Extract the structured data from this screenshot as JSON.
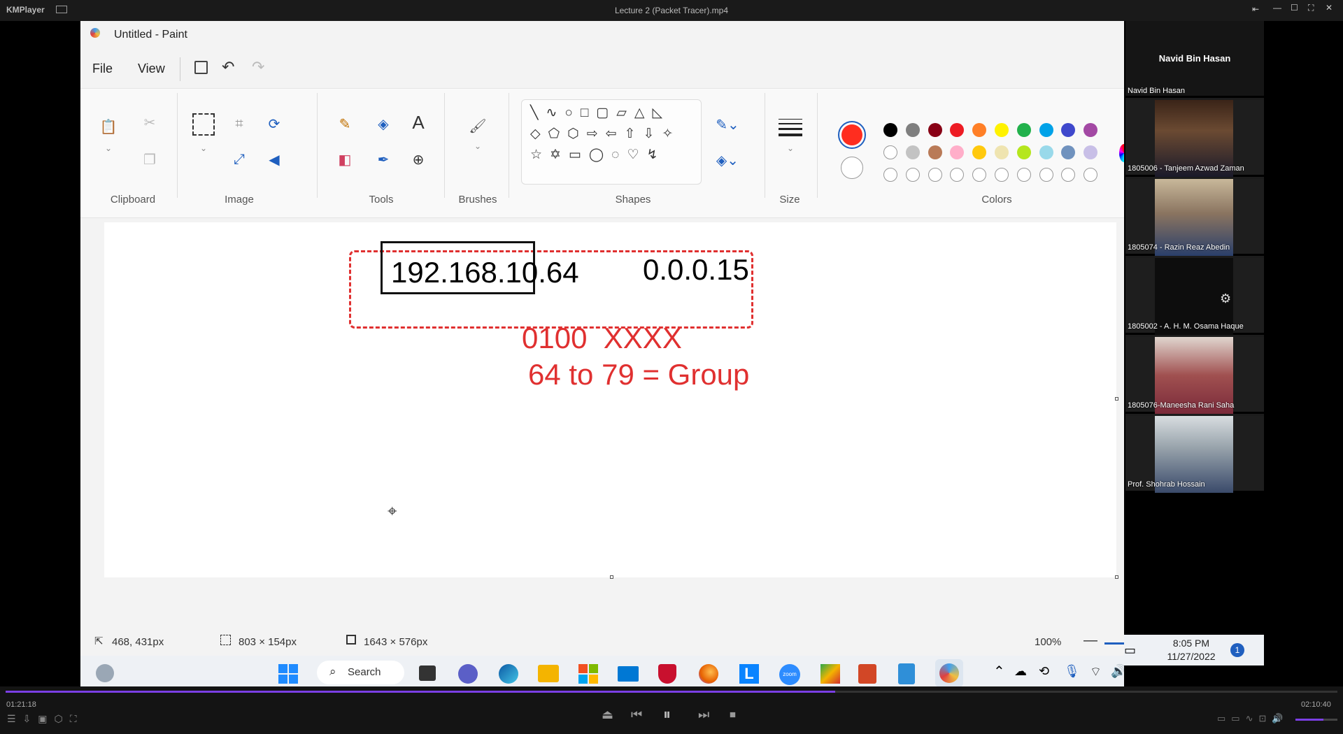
{
  "player": {
    "app_name": "KMPlayer",
    "file_title": "Lecture 2 (Packet  Tracer).mp4",
    "elapsed": "01:21:18",
    "total": "02:10:40",
    "progress_fraction": 0.623
  },
  "paint": {
    "window_title": "Untitled - Paint",
    "menu": {
      "file": "File",
      "view": "View"
    },
    "groups": {
      "clipboard": "Clipboard",
      "image": "Image",
      "tools": "Tools",
      "brushes": "Brushes",
      "shapes": "Shapes",
      "size": "Size",
      "colors": "Colors"
    },
    "primary_color": "#ff2d1f",
    "secondary_color": "#ffffff",
    "palette_row1": [
      "#000000",
      "#7f7f7f",
      "#880015",
      "#ed1c24",
      "#ff7f27",
      "#fff200",
      "#22b14c",
      "#00a2e8",
      "#3f48cc",
      "#a349a4"
    ],
    "palette_row2": [
      "#ffffff",
      "#c3c3c3",
      "#b97a57",
      "#ffaec9",
      "#ffc90e",
      "#efe4b0",
      "#b5e61d",
      "#99d9ea",
      "#7092be",
      "#c8bfe7"
    ],
    "canvas_text": {
      "ip_address": "192.168.10.64",
      "wildcard": "0.0.0.15",
      "binary_line": "0100  XXXX",
      "group_line": "64 to 79 = Group"
    },
    "status": {
      "cursor_pos": "468, 431px",
      "selection_size": "803 × 154px",
      "canvas_size": "1643 × 576px",
      "zoom": "100%"
    }
  },
  "taskbar": {
    "search_label": "Search",
    "time": "8:05 PM",
    "date": "11/27/2022",
    "notification_count": "1"
  },
  "participants": {
    "host_name": "Navid Bin Hasan",
    "host_label": "Navid Bin Hasan",
    "tiles": [
      {
        "name": "1805006 - Tanjeem Azwad Zaman"
      },
      {
        "name": "1805074 - Razin Reaz Abedin"
      },
      {
        "name": "1805002 - A. H. M. Osama Haque"
      },
      {
        "name": "1805076-Maneesha Rani Saha"
      },
      {
        "name": "Prof. Shohrab Hossain"
      }
    ]
  }
}
